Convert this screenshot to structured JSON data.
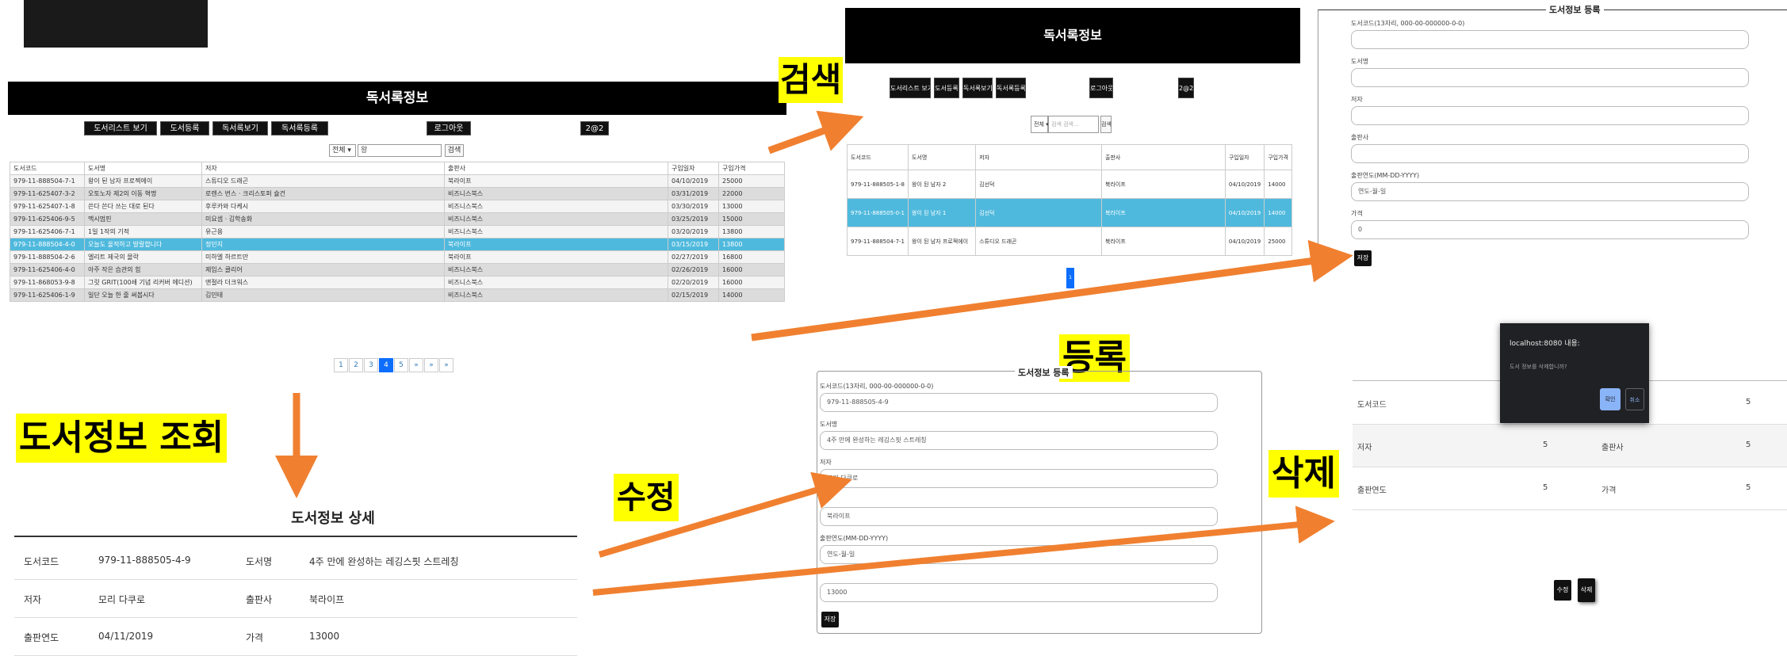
{
  "labels": {
    "search": "검색",
    "view": "도서정보 조회",
    "register": "등록",
    "edit": "수정",
    "delete": "삭제"
  },
  "list_panel": {
    "header": "독서록정보",
    "nav": [
      "도서리스트 보기",
      "도서등록",
      "독서록보기",
      "독서록등록",
      "로그아웃",
      "2@2"
    ],
    "search_select": "전체 ▾",
    "search_value": "왕",
    "search_button": "검색",
    "columns": [
      "도서코드",
      "도서명",
      "저자",
      "출판사",
      "구입일자",
      "구입가격"
    ],
    "rows": [
      [
        "979-11-888504-7-1",
        "왕이 된 남자 프로젝에이",
        "스튜디오 드래곤",
        "북라이프",
        "04/10/2019",
        "25000"
      ],
      [
        "979-11-625407-3-2",
        "오토노자 제2의 이동 혁명",
        "로렌스 번스 · 크리스토퍼 슐건",
        "비즈니스북스",
        "03/31/2019",
        "22000"
      ],
      [
        "979-11-625407-1-8",
        "쓴다 쓴다 쓰는 대로 된다",
        "후루카와 다케시",
        "비즈니스북스",
        "03/30/2019",
        "13000"
      ],
      [
        "979-11-625406-9-5",
        "맥시멈핀",
        "미요셉 · 김학송화",
        "비즈니스북스",
        "03/25/2019",
        "15000"
      ],
      [
        "979-11-625406-7-1",
        "1일 1작의 기적",
        "유근용",
        "비즈니스북스",
        "03/20/2019",
        "13800"
      ],
      [
        "979-11-888504-4-0",
        "오늘도 울적하고 발랄합니다",
        "정민지",
        "북라이프",
        "03/15/2019",
        "13800"
      ],
      [
        "979-11-888504-2-6",
        "엘리트 제국의 몰락",
        "미하엘 하르트만",
        "북라이프",
        "02/27/2019",
        "16800"
      ],
      [
        "979-11-625406-4-0",
        "아주 작은 습관의 힘",
        "제임스 클리어",
        "비즈니스북스",
        "02/26/2019",
        "16000"
      ],
      [
        "979-11-868053-9-8",
        "그릿 GRIT(100쇄 기념 리커버 에디션)",
        "앤절라 더크워스",
        "비즈니스북스",
        "02/20/2019",
        "16000"
      ],
      [
        "979-11-625406-1-9",
        "일단 오늘 한 줄 써봅시다",
        "김민태",
        "비즈니스북스",
        "02/15/2019",
        "14000"
      ]
    ],
    "pager": [
      "1",
      "2",
      "3",
      "4",
      "5",
      "»",
      "»",
      "»"
    ]
  },
  "detail_panel": {
    "title": "도서정보 상세",
    "rows": [
      [
        "도서코드",
        "979-11-888505-4-9",
        "도서명",
        "4주 만에 완성하는 레깅스핏 스트레칭"
      ],
      [
        "저자",
        "모리 다쿠로",
        "출판사",
        "북라이프"
      ],
      [
        "출판연도",
        "04/11/2019",
        "가격",
        "13000"
      ]
    ]
  },
  "search_panel": {
    "header": "독서록정보",
    "nav": [
      "도서리스트 보기",
      "도서등록",
      "독서록보기",
      "독서록등록",
      "로그아웃",
      "2@2"
    ],
    "search_select": "전체 ▾",
    "search_placeholder": "검색 검색...",
    "search_button": "검색",
    "columns": [
      "도서코드",
      "도서명",
      "저자",
      "출판사",
      "구입일자",
      "구입가격"
    ],
    "rows": [
      [
        "979-11-888505-1-8",
        "왕이 된 남자 2",
        "김선덕",
        "북라이프",
        "04/10/2019",
        "14000"
      ],
      [
        "979-11-888505-0-1",
        "왕이 된 남자 1",
        "김선덕",
        "북라이프",
        "04/10/2019",
        "14000"
      ],
      [
        "979-11-888504-7-1",
        "왕이 된 남자 프로젝에이",
        "스튜디오 드래곤",
        "북라이프",
        "04/10/2019",
        "25000"
      ]
    ],
    "page": "1"
  },
  "register_panel": {
    "title": "도서정보 등록",
    "fields": [
      {
        "label": "도서코드(13자리, 000-00-000000-0-0)",
        "value": ""
      },
      {
        "label": "도서명",
        "value": ""
      },
      {
        "label": "저자",
        "value": ""
      },
      {
        "label": "출판사",
        "value": ""
      },
      {
        "label": "출판연도(MM-DD-YYYY)",
        "value": "연도-월-일"
      },
      {
        "label": "가격",
        "value": "0"
      }
    ],
    "save": "저장"
  },
  "edit_panel": {
    "title": "도서정보 등록",
    "fields": [
      {
        "label": "도서코드(13자리, 000-00-000000-0-0)",
        "value": "979-11-888505-4-9"
      },
      {
        "label": "도서명",
        "value": "4주 만에 완성하는 레깅스핏 스트레칭"
      },
      {
        "label": "저자",
        "value": "모리 다쿠로"
      },
      {
        "label": "",
        "value": "북라이프"
      },
      {
        "label": "출판연도(MM-DD-YYYY)",
        "value": "연도-월-일"
      },
      {
        "label": "",
        "value": "13000"
      }
    ],
    "save": "저장"
  },
  "delete_panel": {
    "dialog_title": "localhost:8080 내용:",
    "dialog_message": "도서 정보를 삭제합니까?",
    "ok": "확인",
    "cancel": "취소",
    "rows": [
      [
        "도서코드",
        "",
        "",
        "5"
      ],
      [
        "저자",
        "5",
        "출판사",
        "5"
      ],
      [
        "출판연도",
        "5",
        "가격",
        "5"
      ]
    ],
    "edit_button": "수정",
    "delete_button": "삭제"
  },
  "colors": {
    "label_bg": "#ffff00",
    "arrow": "#f08030",
    "highlight_row": "#4fb9dd",
    "header_bg": "#000000"
  }
}
